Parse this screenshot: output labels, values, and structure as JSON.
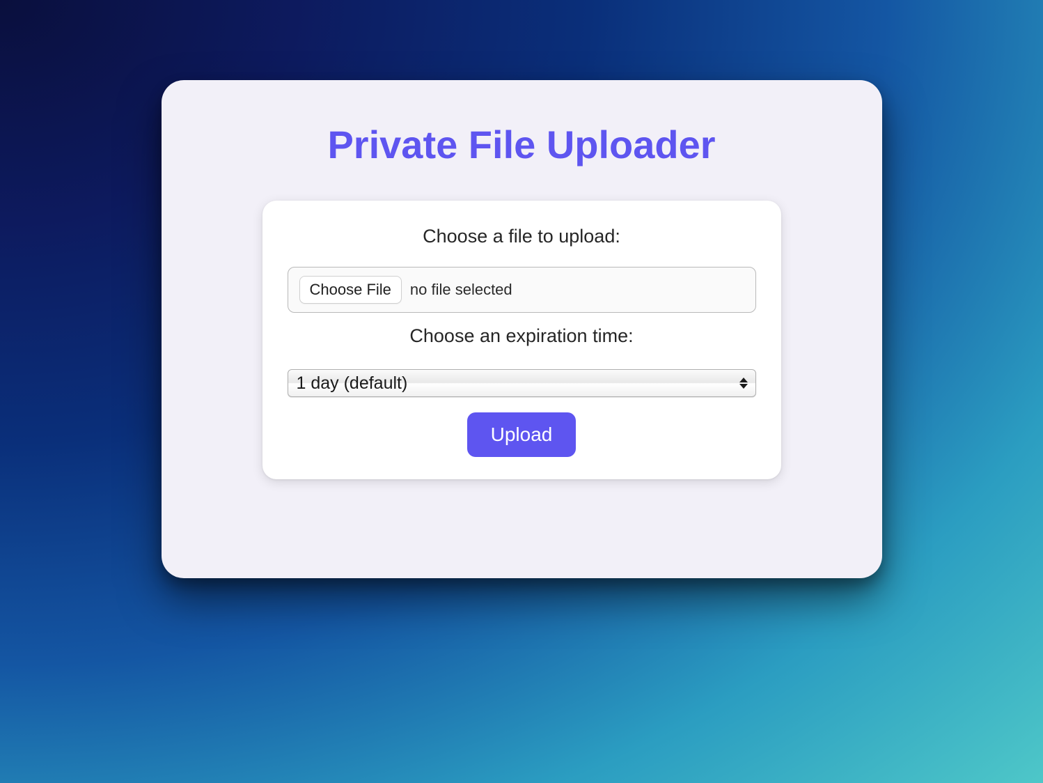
{
  "app": {
    "title": "Private File Uploader"
  },
  "form": {
    "file_label": "Choose a file to upload:",
    "file_button_label": "Choose File",
    "file_status": "no file selected",
    "expiration_label": "Choose an expiration time:",
    "expiration_selected": "1 day (default)",
    "upload_button_label": "Upload"
  }
}
